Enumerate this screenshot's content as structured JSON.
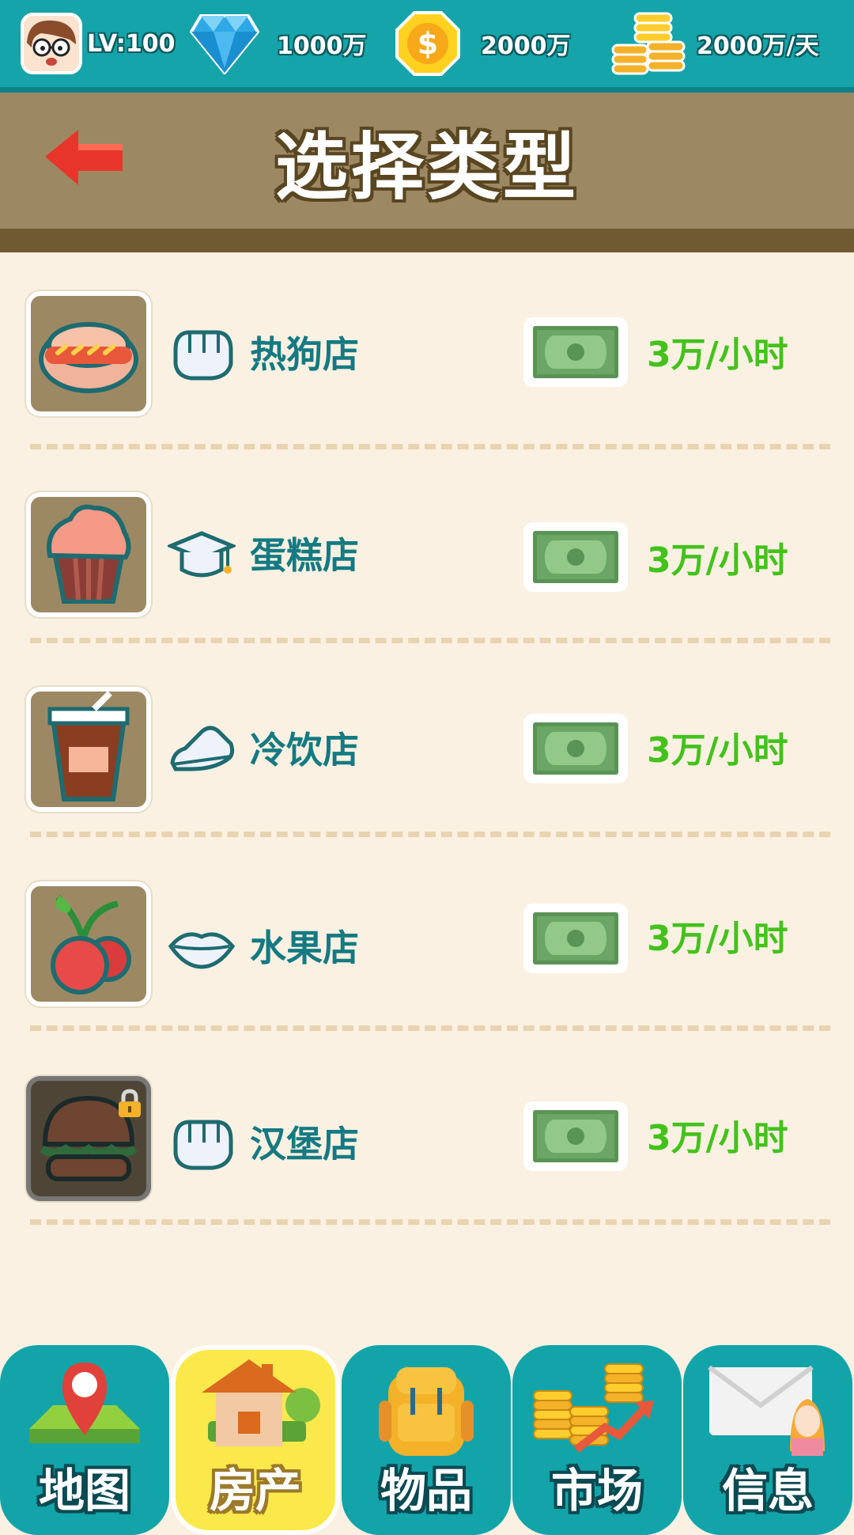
{
  "status_bar": {
    "level": "LV:100",
    "diamonds": "1000万",
    "coins": "2000万",
    "income_rate": "2000万/天"
  },
  "header": {
    "title": "选择类型"
  },
  "shops": [
    {
      "name": "热狗店",
      "icon": "hotdog-icon",
      "trait_icon": "fist-icon",
      "income": "3万/小时",
      "locked": false
    },
    {
      "name": "蛋糕店",
      "icon": "cupcake-icon",
      "trait_icon": "graduation-cap-icon",
      "income": "3万/小时",
      "locked": false
    },
    {
      "name": "冷饮店",
      "icon": "cold-drink-icon",
      "trait_icon": "sneaker-icon",
      "income": "3万/小时",
      "locked": false
    },
    {
      "name": "水果店",
      "icon": "cherry-icon",
      "trait_icon": "lips-icon",
      "income": "3万/小时",
      "locked": false
    },
    {
      "name": "汉堡店",
      "icon": "burger-icon",
      "trait_icon": "fist-icon",
      "income": "3万/小时",
      "locked": true
    }
  ],
  "nav": {
    "tabs": [
      {
        "label": "地图",
        "icon": "map-pin-icon",
        "active": false
      },
      {
        "label": "房产",
        "icon": "house-icon",
        "active": true
      },
      {
        "label": "物品",
        "icon": "backpack-icon",
        "active": false
      },
      {
        "label": "市场",
        "icon": "coin-stack-chart-icon",
        "active": false
      },
      {
        "label": "信息",
        "icon": "mail-icon",
        "active": false
      }
    ]
  },
  "colors": {
    "teal": "#15a4a9",
    "header_brown": "#9c8964",
    "income_green": "#43c21c",
    "name_teal": "#147a82",
    "active_tab_yellow": "#fbe84b"
  }
}
